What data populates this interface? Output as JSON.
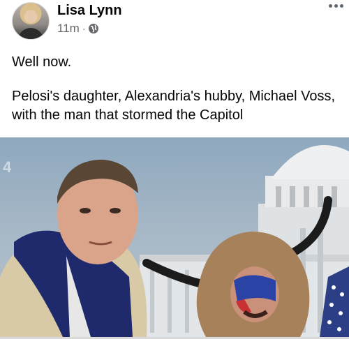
{
  "post": {
    "author": "Lisa Lynn",
    "timestamp": "11m",
    "separator": "·",
    "privacy_icon": "globe-icon",
    "more_icon": "more-options-icon",
    "text_line1": "Well now.",
    "text_line2": "Pelosi's daughter, Alexandria's hubby, Michael Voss,  with the man that stormed the Capitol",
    "photo_corner_mark": "4"
  }
}
